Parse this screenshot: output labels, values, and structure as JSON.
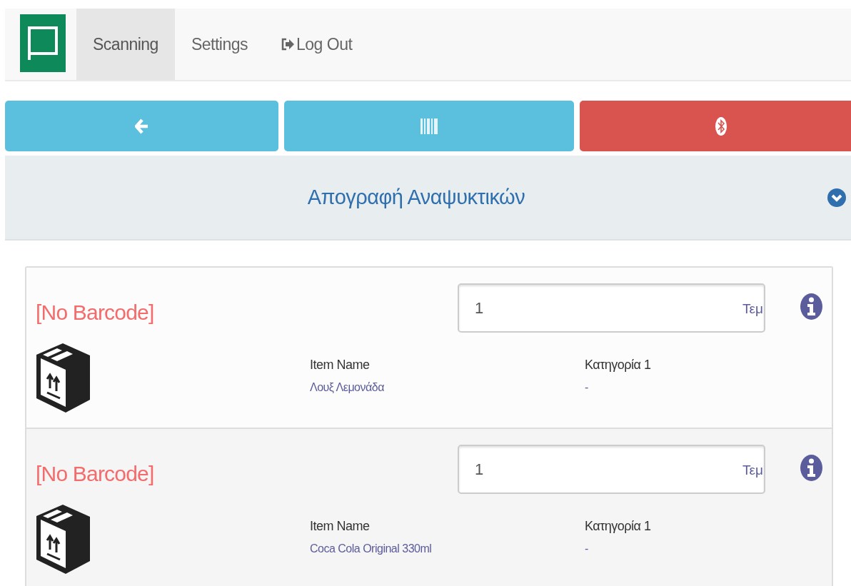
{
  "nav": {
    "tabs": [
      {
        "label": "Scanning",
        "selected": true,
        "kind": "text"
      },
      {
        "label": "Settings",
        "selected": false,
        "kind": "text"
      },
      {
        "label": "Log Out",
        "selected": false,
        "kind": "logout"
      }
    ]
  },
  "actions": [
    {
      "kind": "back",
      "color": "#5bc0de"
    },
    {
      "kind": "barcode",
      "color": "#5bc0de"
    },
    {
      "kind": "bluetooth",
      "color": "#d9534f"
    }
  ],
  "header": {
    "title": "Απογραφή Αναψυκτικών"
  },
  "items": [
    {
      "barcode": "[No Barcode]",
      "quantity": "1",
      "unit": "Τεμ",
      "fields": [
        {
          "label": "Item Name",
          "value": "Λουξ Λεμονάδα"
        },
        {
          "label": "Κατηγορία 1",
          "value": "-"
        }
      ]
    },
    {
      "barcode": "[No Barcode]",
      "quantity": "1",
      "unit": "Τεμ",
      "fields": [
        {
          "label": "Item Name",
          "value": "Coca Cola Original 330ml"
        },
        {
          "label": "Κατηγορία 1",
          "value": "-"
        }
      ]
    }
  ]
}
